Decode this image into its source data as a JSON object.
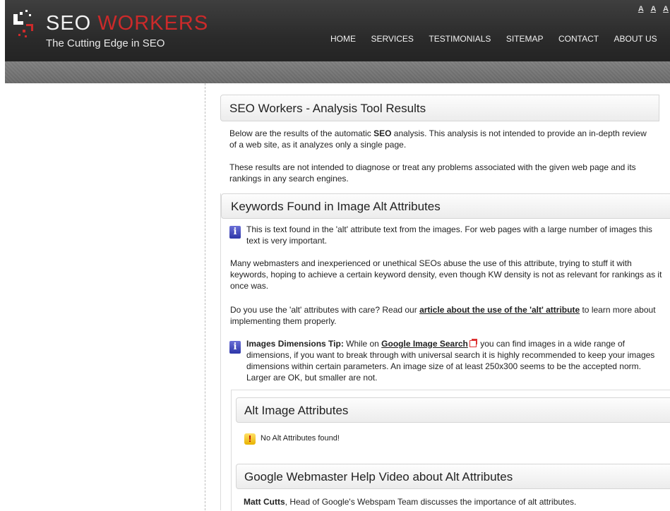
{
  "header": {
    "logo_word1": "SEO",
    "logo_word2": "WORKERS",
    "tagline": "The Cutting Edge in SEO",
    "font_size_controls": [
      "A",
      "A",
      "A"
    ],
    "nav": [
      "HOME",
      "SERVICES",
      "TESTIMONIALS",
      "SITEMAP",
      "CONTACT",
      "ABOUT US"
    ]
  },
  "main": {
    "title": "SEO Workers - Analysis Tool Results",
    "intro_1_before": "Below are the results of the automatic ",
    "intro_1_bold": "SEO",
    "intro_1_after": " analysis. This analysis is not intended to provide an in-depth review of a web site, as it analyzes only a single page.",
    "intro_2": "These results are not intended to diagnose or treat any problems associated with the given web page and its rankings in any search engines."
  },
  "keywords_section": {
    "title": "Keywords Found in Image Alt Attributes",
    "info_1": "This is text found in the 'alt' attribute text from the images. For web pages with a large number of images this text is very important.",
    "para_2": "Many webmasters and inexperienced or unethical SEOs abuse the use of this attribute, trying to stuff it with keywords, hoping to achieve a certain keyword density, even though KW density is not as relevant for rankings as it once was.",
    "para_3_before": "Do you use the 'alt' attributes with care? Read our ",
    "para_3_link": "article about the use of the 'alt' attribute",
    "para_3_after": " to learn more about implementing them properly.",
    "tip_label": "Images Dimensions Tip:",
    "tip_before": " While on ",
    "tip_link": "Google Image Search",
    "tip_after": " you can find images in a wide range of dimensions, if you want to break through with universal search it is highly recommended to keep your images dimensions within certain parameters. An image size of at least 250x300 seems to be the accepted norm. Larger are OK, but smaller are not."
  },
  "alt_box": {
    "title": "Alt Image Attributes",
    "warning": "No Alt Attributes found!",
    "video_title": "Google Webmaster Help Video about Alt Attributes",
    "video_author": "Matt Cutts",
    "video_desc": ", Head of Google's Webspam Team discusses the importance of alt attributes."
  },
  "icons": {
    "info": "i",
    "warning": "!"
  },
  "colors": {
    "header_bg": "#2f2f2f",
    "logo_red": "#cc2a2a",
    "info_blue": "#2c35a8",
    "warning_yellow": "#e8b200"
  }
}
